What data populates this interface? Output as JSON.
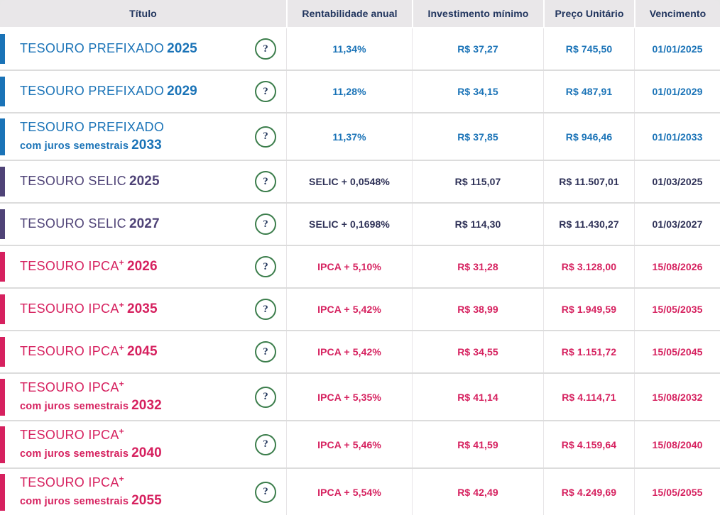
{
  "header": {
    "columns": [
      "Título",
      "Rentabilidade anual",
      "Investimento mínimo",
      "Preço Unitário",
      "Vencimento"
    ]
  },
  "help_icon": {
    "glyph": "?"
  },
  "theme_colors": {
    "prefixado_blue": "#1a73b7",
    "selic_purple": "#4f4377",
    "selic_value_navy": "#2e3157",
    "ipca_pink": "#d6215f",
    "help_green": "#3b7d4b",
    "header_bg": "#e9e7e9",
    "header_text": "#21355e"
  },
  "rows": [
    {
      "type": "prefixado",
      "name": "TESOURO PREFIXADO",
      "sup": "",
      "subtitle": "",
      "year": "2025",
      "rate": "11,34%",
      "min_investment": "R$ 37,27",
      "unit_price": "R$ 745,50",
      "maturity": "01/01/2025"
    },
    {
      "type": "prefixado",
      "name": "TESOURO PREFIXADO",
      "sup": "",
      "subtitle": "",
      "year": "2029",
      "rate": "11,28%",
      "min_investment": "R$ 34,15",
      "unit_price": "R$ 487,91",
      "maturity": "01/01/2029"
    },
    {
      "type": "prefixado",
      "name": "TESOURO PREFIXADO",
      "sup": "",
      "subtitle": "com juros semestrais",
      "year": "2033",
      "rate": "11,37%",
      "min_investment": "R$ 37,85",
      "unit_price": "R$ 946,46",
      "maturity": "01/01/2033"
    },
    {
      "type": "selic",
      "name": "TESOURO SELIC",
      "sup": "",
      "subtitle": "",
      "year": "2025",
      "rate": "SELIC + 0,0548%",
      "min_investment": "R$ 115,07",
      "unit_price": "R$ 11.507,01",
      "maturity": "01/03/2025"
    },
    {
      "type": "selic",
      "name": "TESOURO SELIC",
      "sup": "",
      "subtitle": "",
      "year": "2027",
      "rate": "SELIC + 0,1698%",
      "min_investment": "R$ 114,30",
      "unit_price": "R$ 11.430,27",
      "maturity": "01/03/2027"
    },
    {
      "type": "ipca",
      "name": "TESOURO IPCA",
      "sup": "+",
      "subtitle": "",
      "year": "2026",
      "rate": "IPCA + 5,10%",
      "min_investment": "R$ 31,28",
      "unit_price": "R$ 3.128,00",
      "maturity": "15/08/2026"
    },
    {
      "type": "ipca",
      "name": "TESOURO IPCA",
      "sup": "+",
      "subtitle": "",
      "year": "2035",
      "rate": "IPCA + 5,42%",
      "min_investment": "R$ 38,99",
      "unit_price": "R$ 1.949,59",
      "maturity": "15/05/2035"
    },
    {
      "type": "ipca",
      "name": "TESOURO IPCA",
      "sup": "+",
      "subtitle": "",
      "year": "2045",
      "rate": "IPCA + 5,42%",
      "min_investment": "R$ 34,55",
      "unit_price": "R$ 1.151,72",
      "maturity": "15/05/2045"
    },
    {
      "type": "ipca",
      "name": "TESOURO IPCA",
      "sup": "+",
      "subtitle": "com juros semestrais",
      "year": "2032",
      "rate": "IPCA + 5,35%",
      "min_investment": "R$ 41,14",
      "unit_price": "R$ 4.114,71",
      "maturity": "15/08/2032"
    },
    {
      "type": "ipca",
      "name": "TESOURO IPCA",
      "sup": "+",
      "subtitle": "com juros semestrais",
      "year": "2040",
      "rate": "IPCA + 5,46%",
      "min_investment": "R$ 41,59",
      "unit_price": "R$ 4.159,64",
      "maturity": "15/08/2040"
    },
    {
      "type": "ipca",
      "name": "TESOURO IPCA",
      "sup": "+",
      "subtitle": "com juros semestrais",
      "year": "2055",
      "rate": "IPCA + 5,54%",
      "min_investment": "R$ 42,49",
      "unit_price": "R$ 4.249,69",
      "maturity": "15/05/2055"
    }
  ]
}
